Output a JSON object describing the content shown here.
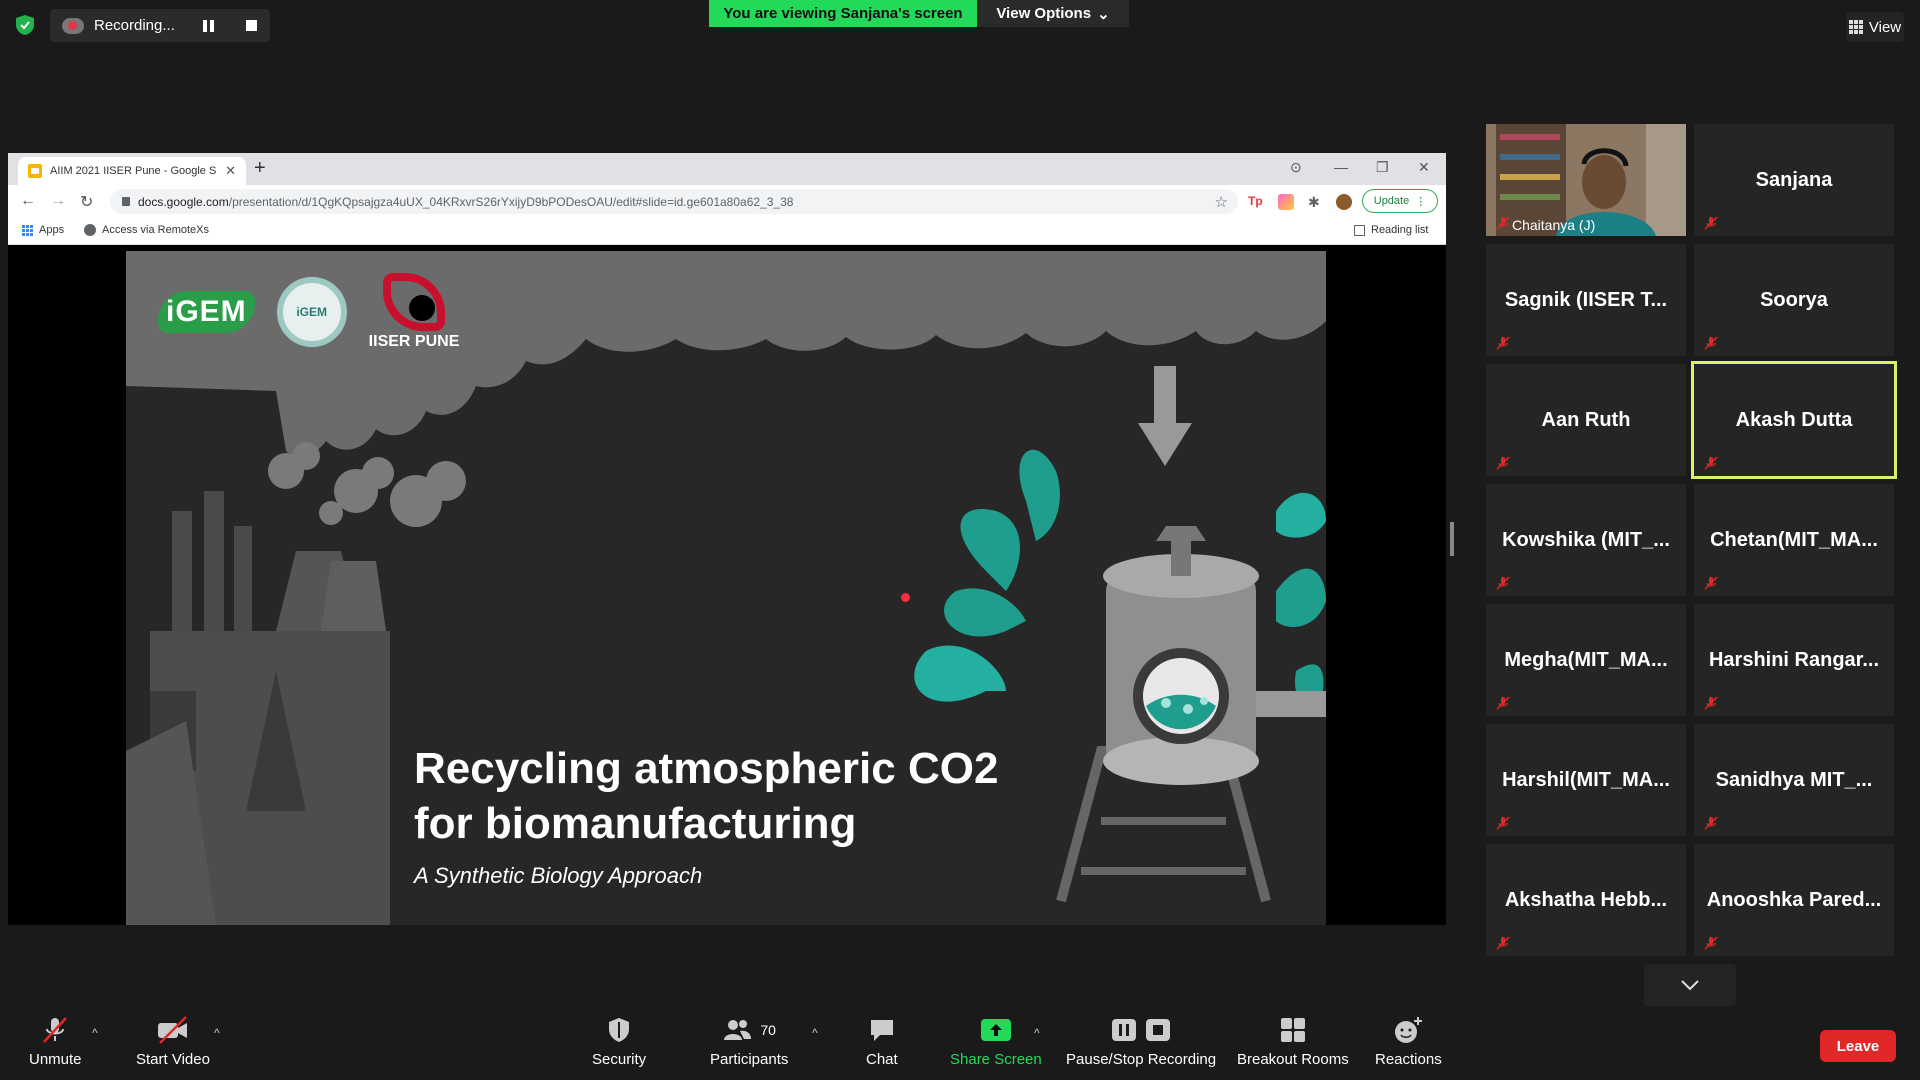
{
  "recording": {
    "label": "Recording..."
  },
  "banner": {
    "viewing": "You are viewing Sanjana's screen",
    "view_options": "View Options"
  },
  "view_button": {
    "label": "View"
  },
  "browser": {
    "tab_title": "AIIM 2021 IISER Pune - Google S",
    "url_host": "docs.google.com",
    "url_path": "/presentation/d/1QgKQpsajgza4uUX_04KRxvrS26rYxijyD9bPODesOAU/edit#slide=id.ge601a80a62_3_38",
    "update_label": "Update",
    "bookmarks": {
      "apps": "Apps",
      "remotexs": "Access via RemoteXs",
      "reading_list": "Reading list"
    }
  },
  "slide": {
    "logo_igem": "iGEM",
    "logo_igem_seal": "iGEM",
    "logo_iiser": "IISER PUNE",
    "title_line1": "Recycling atmospheric CO2",
    "title_line2": "for biomanufacturing",
    "subtitle": "A Synthetic Biology Approach"
  },
  "participants": [
    {
      "name": "Chaitanya (J)",
      "video": true
    },
    {
      "name": "Sanjana"
    },
    {
      "name": "Sagnik (IISER T..."
    },
    {
      "name": "Soorya"
    },
    {
      "name": "Aan Ruth"
    },
    {
      "name": "Akash Dutta",
      "active": true
    },
    {
      "name": "Kowshika (MIT_..."
    },
    {
      "name": "Chetan(MIT_MA..."
    },
    {
      "name": "Megha(MIT_MA..."
    },
    {
      "name": "Harshini Rangar..."
    },
    {
      "name": "Harshil(MIT_MA..."
    },
    {
      "name": "Sanidhya MIT_..."
    },
    {
      "name": "Akshatha Hebb..."
    },
    {
      "name": "Anooshka Pared..."
    }
  ],
  "toolbar": {
    "unmute": "Unmute",
    "start_video": "Start Video",
    "security": "Security",
    "participants": "Participants",
    "participant_count": "70",
    "chat": "Chat",
    "share_screen": "Share Screen",
    "pause_stop_recording": "Pause/Stop Recording",
    "breakout_rooms": "Breakout Rooms",
    "reactions": "Reactions",
    "leave": "Leave"
  },
  "colors": {
    "banner_green": "#23d959",
    "share_green": "#23d959",
    "leave_red": "#e02828",
    "active_speaker": "#d6f36b",
    "mute_red": "#e02828"
  }
}
